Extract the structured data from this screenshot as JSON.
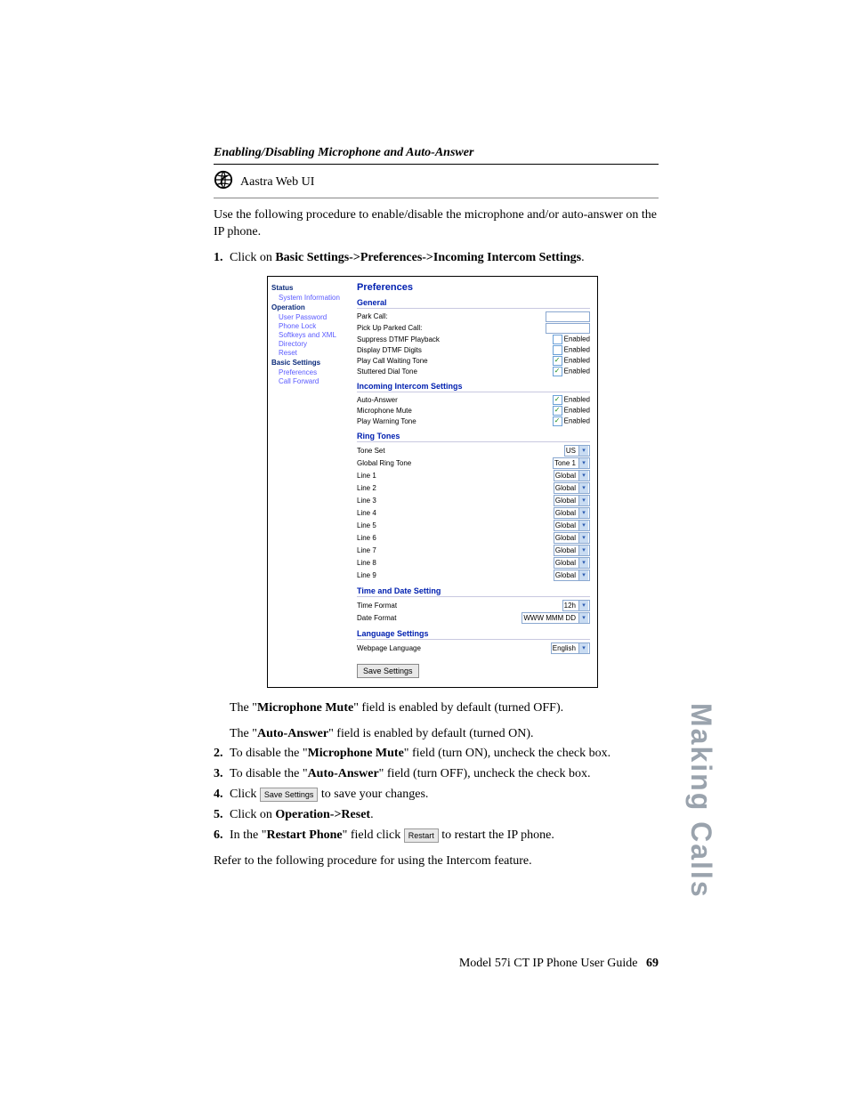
{
  "header": {
    "section_title": "Enabling/Disabling Microphone and Auto-Answer",
    "subhead": "Aastra Web UI"
  },
  "intro": "Use the following procedure to enable/disable the microphone and/or auto-answer on the IP phone.",
  "step1": {
    "num": "1.",
    "pre": "Click on ",
    "bold": "Basic Settings->Preferences->Incoming Intercom Settings",
    "post": "."
  },
  "screenshot": {
    "nav": {
      "status": "Status",
      "system_info": "System Information",
      "operation": "Operation",
      "user_password": "User Password",
      "phone_lock": "Phone Lock",
      "softkeys_xml": "Softkeys and XML",
      "directory": "Directory",
      "reset": "Reset",
      "basic_settings": "Basic Settings",
      "preferences": "Preferences",
      "call_forward": "Call Forward"
    },
    "main": {
      "title": "Preferences",
      "general": {
        "header": "General",
        "park_call": "Park Call:",
        "pickup": "Pick Up Parked Call:",
        "suppress_dtmf": "Suppress DTMF Playback",
        "display_dtmf": "Display DTMF Digits",
        "play_cwt": "Play Call Waiting Tone",
        "stutter": "Stuttered Dial Tone",
        "enabled": "Enabled"
      },
      "intercom": {
        "header": "Incoming Intercom Settings",
        "auto_answer": "Auto-Answer",
        "mic_mute": "Microphone Mute",
        "play_warn": "Play Warning Tone",
        "enabled": "Enabled"
      },
      "ring": {
        "header": "Ring Tones",
        "tone_set": "Tone Set",
        "tone_set_val": "US",
        "global_ring": "Global Ring Tone",
        "global_ring_val": "Tone 1",
        "l1": "Line 1",
        "l2": "Line 2",
        "l3": "Line 3",
        "l4": "Line 4",
        "l5": "Line 5",
        "l6": "Line 6",
        "l7": "Line 7",
        "l8": "Line 8",
        "l9": "Line 9",
        "global": "Global"
      },
      "time": {
        "header": "Time and Date Setting",
        "time_format": "Time Format",
        "time_val": "12h",
        "date_format": "Date Format",
        "date_val": "WWW MMM DD"
      },
      "lang": {
        "header": "Language Settings",
        "webpage_lang": "Webpage Language",
        "lang_val": "English"
      },
      "save_btn": "Save Settings"
    }
  },
  "aftershot": {
    "mute_note_pre": "The \"",
    "mute_note_bold": "Microphone Mute",
    "mute_note_post": "\" field is enabled by default (turned OFF).",
    "auto_note_pre": "The \"",
    "auto_note_bold": "Auto-Answer",
    "auto_note_post": "\" field is enabled by default (turned ON)."
  },
  "step2": {
    "num": "2.",
    "pre": "To disable the \"",
    "bold": "Microphone Mute",
    "post": "\" field (turn ON), uncheck the check box."
  },
  "step3": {
    "num": "3.",
    "pre": "To disable the \"",
    "bold": "Auto-Answer",
    "post": "\" field (turn OFF), uncheck the check box."
  },
  "step4": {
    "num": "4.",
    "pre": "Click ",
    "btn": "Save Settings",
    "post": " to save your changes."
  },
  "step5": {
    "num": "5.",
    "pre": "Click on ",
    "bold": "Operation->Reset",
    "post": "."
  },
  "step6": {
    "num": "6.",
    "pre": "In the \"",
    "bold": "Restart Phone",
    "mid": "\" field click ",
    "btn": "Restart",
    "post": " to restart the IP phone."
  },
  "closing": "Refer to the following procedure for using the Intercom feature.",
  "footer": {
    "guide": "Model 57i CT IP Phone User Guide",
    "page": "69"
  },
  "side_tab": "Making Calls"
}
